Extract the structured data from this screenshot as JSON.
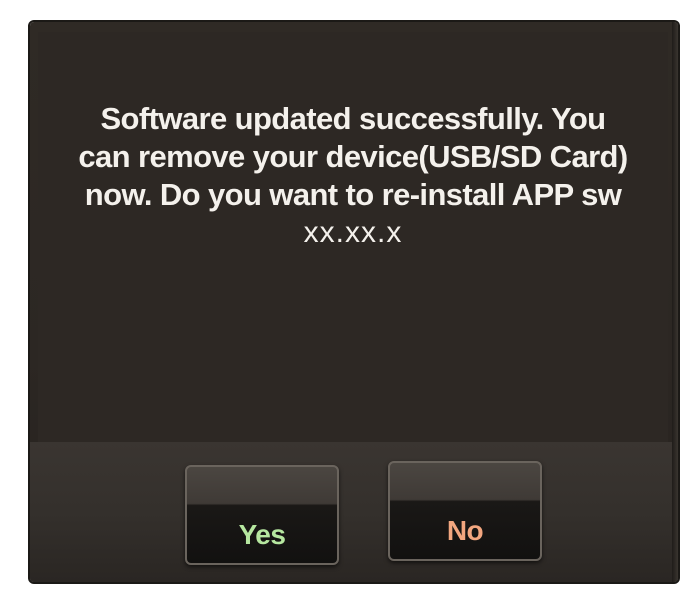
{
  "dialog": {
    "message_lines": [
      "Software updated successfully. You",
      "can remove your device(USB/SD Card)",
      "now. Do you want to re-install APP sw"
    ],
    "version": "xx.xx.x"
  },
  "buttons": {
    "yes_label": "Yes",
    "no_label": "No"
  },
  "colors": {
    "yes_text": "#b6e7a0",
    "no_text": "#f2a67f",
    "screen_bg": "#2d2824"
  }
}
